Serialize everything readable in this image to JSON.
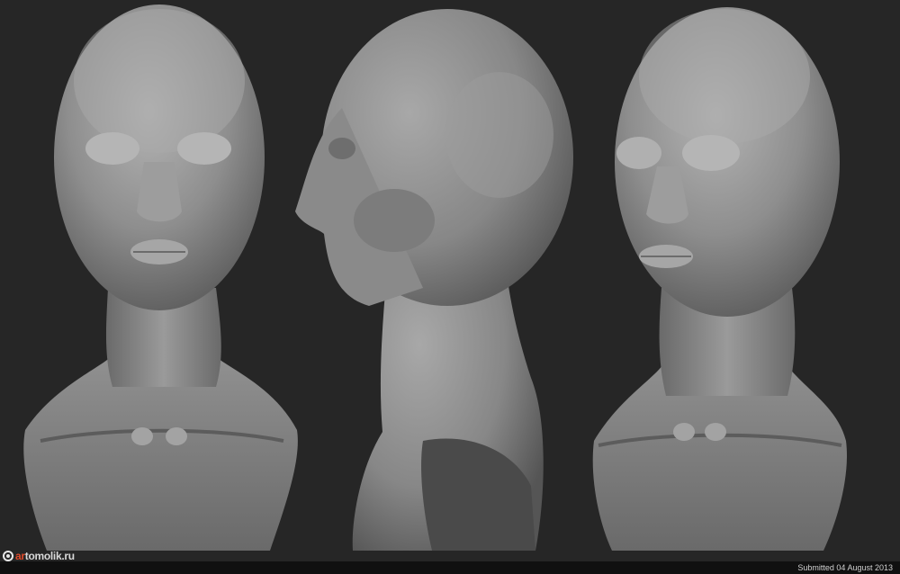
{
  "watermark": {
    "logo_text": "artomolik.ru",
    "logo_prefix": "ar",
    "logo_rest": "tomolik.ru"
  },
  "footer": {
    "submitted": "Submitted 04 August 2013"
  },
  "scene": {
    "background": "#262626",
    "sculpt_color": "#8f8f8f",
    "views": [
      "front",
      "side",
      "three-quarter"
    ]
  }
}
